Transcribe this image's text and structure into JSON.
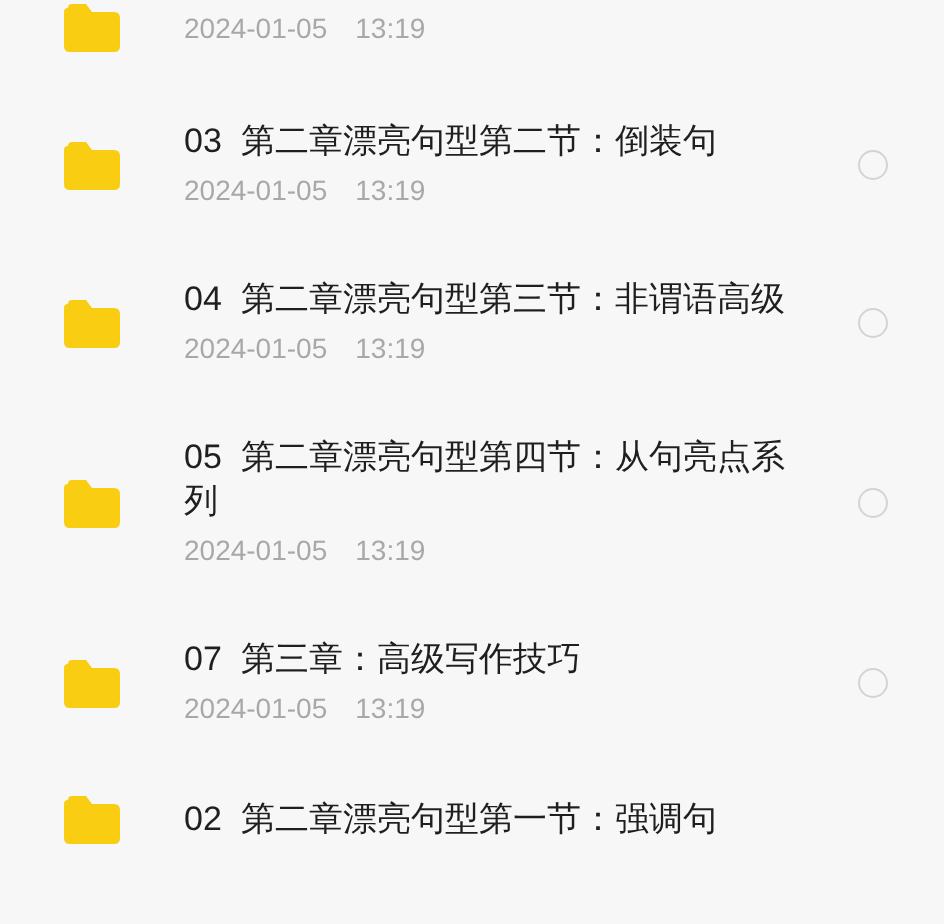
{
  "files": [
    {
      "date": "2024-01-05",
      "time": "13:19"
    },
    {
      "title": "03  第二章漂亮句型第二节：倒装句",
      "date": "2024-01-05",
      "time": "13:19",
      "selected": false
    },
    {
      "title": "04  第二章漂亮句型第三节：非谓语高级",
      "date": "2024-01-05",
      "time": "13:19",
      "selected": false
    },
    {
      "title": "05  第二章漂亮句型第四节：从句亮点系列",
      "date": "2024-01-05",
      "time": "13:19",
      "selected": false
    },
    {
      "title": "07  第三章：高级写作技巧",
      "date": "2024-01-05",
      "time": "13:19",
      "selected": false
    },
    {
      "title": "02  第二章漂亮句型第一节：强调句"
    }
  ]
}
